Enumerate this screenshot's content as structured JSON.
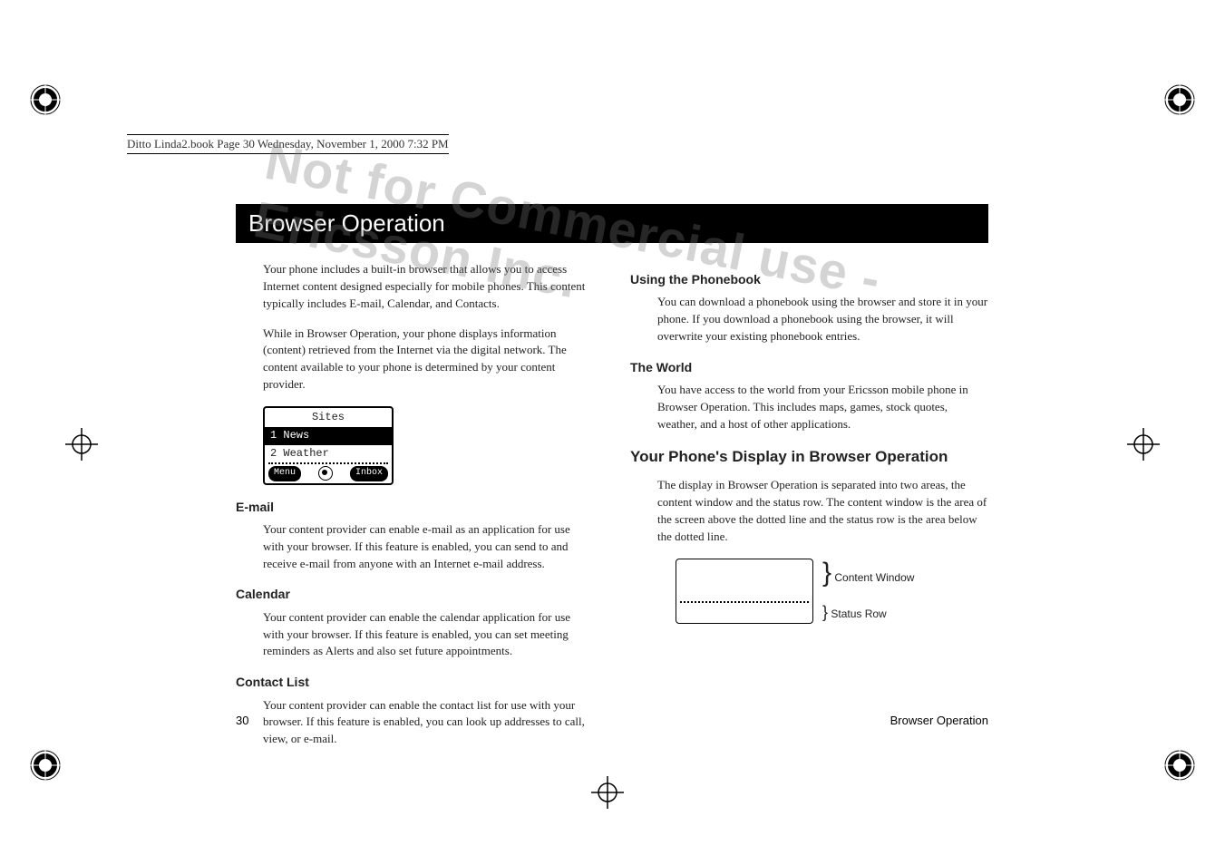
{
  "header_info": "Ditto Linda2.book  Page 30  Wednesday, November 1, 2000  7:32 PM",
  "title": "Browser Operation",
  "watermark": "Not for Commercial use - Ericsson Inc.",
  "intro_p1": "Your phone includes a built-in browser that allows you to access Internet content designed especially for mobile phones. This content typically includes E-mail, Calendar, and Contacts.",
  "intro_p2": "While in Browser Operation, your phone displays information (content) retrieved from the Internet via the digital network. The content available to your phone is determined by your content provider.",
  "screen": {
    "title": "Sites",
    "row1": "1 News",
    "row2": "2 Weather",
    "left_soft": "Menu",
    "right_soft": "Inbox"
  },
  "email_head": "E-mail",
  "email_body": "Your content provider can enable e-mail as an application for use with your browser. If this feature is enabled, you can send to and receive e-mail from anyone with an Internet e-mail address.",
  "calendar_head": "Calendar",
  "calendar_body": "Your content provider can enable the calendar application for use with your browser. If this feature is enabled, you can set meeting reminders as Alerts and also set future appointments.",
  "contacts_head": "Contact List",
  "contacts_body": "Your content provider can enable the contact list for use with your browser. If this feature is enabled, you can look up addresses to call, view, or e-mail.",
  "phonebook_head": "Using the Phonebook",
  "phonebook_body": "You can download a phonebook using the browser and store it in your phone. If you download a phonebook using the browser, it will overwrite your existing phonebook entries.",
  "world_head": "The World",
  "world_body": "You have access to the world from your Ericsson mobile phone in Browser Operation. This includes maps, games, stock quotes, weather, and a host of other applications.",
  "display_head": "Your Phone's Display in Browser Operation",
  "display_body": "The display in Browser Operation is separated into two areas, the content window and the status row. The content window is the area of the screen above the dotted line and the status row is the area below the dotted line.",
  "fig_label_content": "Content Window",
  "fig_label_status": "Status Row",
  "footer_page": "30",
  "footer_title": "Browser Operation"
}
